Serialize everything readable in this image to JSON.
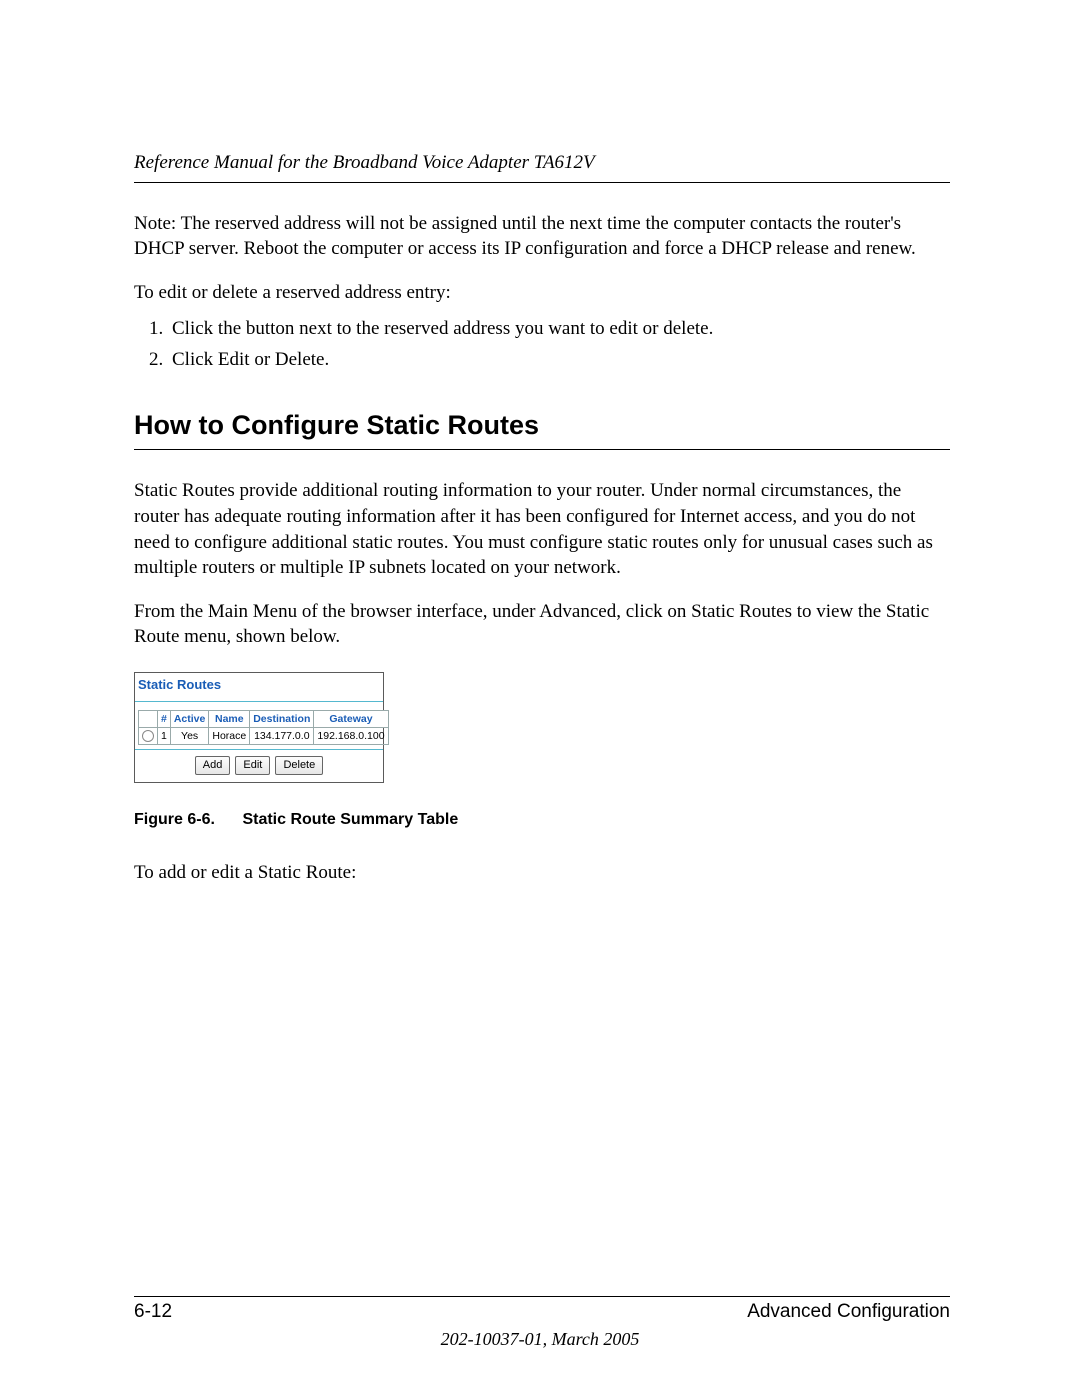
{
  "header": {
    "running_title": "Reference Manual for the Broadband Voice Adapter TA612V"
  },
  "intro": {
    "note": "Note: The reserved address will not be assigned until the next time the computer contacts the router's DHCP server. Reboot the computer or access its IP configuration and force a DHCP release and renew.",
    "edit_delete_lead": "To edit or delete a reserved address entry:",
    "steps": [
      "Click the button next to the reserved address you want to edit or delete.",
      "Click Edit or Delete."
    ]
  },
  "section": {
    "title": "How to Configure Static Routes",
    "p1": "Static Routes provide additional routing information to your router. Under normal circumstances, the router has adequate routing information after it has been configured for Internet access, and you do not need to configure additional static routes. You must configure static routes only for unusual cases such as multiple routers or multiple IP subnets located on your network.",
    "p2": "From the Main Menu of the browser interface, under Advanced, click on Static Routes to view the Static Route menu, shown below."
  },
  "panel": {
    "title": "Static Routes",
    "headers": {
      "num": "#",
      "active": "Active",
      "name": "Name",
      "destination": "Destination",
      "gateway": "Gateway"
    },
    "row": {
      "num": "1",
      "active": "Yes",
      "name": "Horace",
      "destination": "134.177.0.0",
      "gateway": "192.168.0.100"
    },
    "buttons": {
      "add": "Add",
      "edit": "Edit",
      "delete": "Delete"
    }
  },
  "figure": {
    "label": "Figure 6-6.",
    "caption": "Static Route Summary Table"
  },
  "after_figure": {
    "p1": "To add or edit a Static Route:"
  },
  "footer": {
    "page_number": "6-12",
    "chapter": "Advanced Configuration",
    "doc_id": "202-10037-01, March 2005"
  }
}
